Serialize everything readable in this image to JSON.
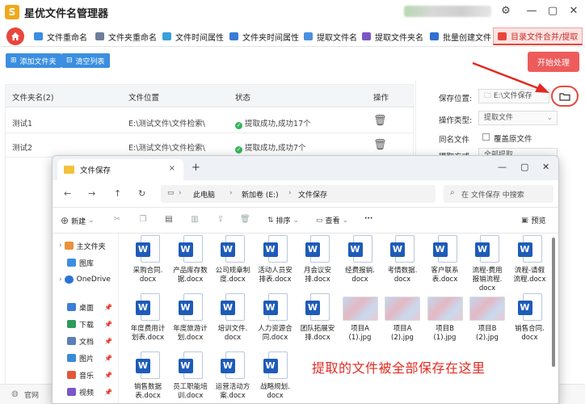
{
  "app": {
    "title": "星优文件名管理器",
    "logo_letter": "S",
    "accent": "#e8463c"
  },
  "tabs": [
    {
      "label": "文件重命名"
    },
    {
      "label": "文件夹重命名"
    },
    {
      "label": "文件时间属性"
    },
    {
      "label": "文件夹时间属性"
    },
    {
      "label": "提取文件名"
    },
    {
      "label": "提取文件夹名"
    },
    {
      "label": "批量创建文件"
    },
    {
      "label": "目录文件合并/提取",
      "active": true
    }
  ],
  "toolbar": {
    "add_folder": "添加文件夹",
    "clear_list": "清空列表",
    "start": "开始处理"
  },
  "table": {
    "headers": [
      "文件夹名(2)",
      "文件位置",
      "状态",
      "操作"
    ],
    "rows": [
      {
        "name": "测试1",
        "path": "E:\\测试文件\\文件检索\\",
        "status": "提取成功,成功17个"
      },
      {
        "name": "测试2",
        "path": "E:\\测试文件\\文件检索\\",
        "status": "提取成功,成功7个"
      }
    ]
  },
  "settings": {
    "save_label": "保存位置:",
    "save_value": "E:\\文件保存",
    "op_label": "操作类型:",
    "op_value": "提取文件",
    "same_label": "同名文件",
    "same_value": "覆盖原文件",
    "extract_label": "提取方式",
    "extract_value": "全部提取"
  },
  "status_bar": {
    "link": "官网"
  },
  "explorer": {
    "tab_title": "文件保存",
    "tab_close": "×",
    "new_tab": "+",
    "breadcrumb": [
      "此电脑",
      "新加卷 (E:)",
      "文件保存"
    ],
    "search_placeholder": "在 文件保存 中搜索",
    "new_label": "新建",
    "sort_label": "排序",
    "view_label": "查看",
    "more_label": "···",
    "preview_label": "预览",
    "sidebar": [
      {
        "label": "主文件夹",
        "color": "#e9913a"
      },
      {
        "label": "图库",
        "color": "#3b8ee0"
      },
      {
        "label": "OneDrive",
        "color": "#2a73d6"
      },
      {
        "label": "桌面",
        "color": "#3d7ed8",
        "pin": true
      },
      {
        "label": "下载",
        "color": "#2e9a5b",
        "pin": true
      },
      {
        "label": "文档",
        "color": "#5b7fb7",
        "pin": true
      },
      {
        "label": "图片",
        "color": "#3a8ad8",
        "pin": true
      },
      {
        "label": "音乐",
        "color": "#e2573a",
        "pin": true
      },
      {
        "label": "视频",
        "color": "#7b56c7",
        "pin": true
      }
    ],
    "files": [
      {
        "name": "采购合同.\ndocx",
        "type": "docx"
      },
      {
        "name": "产品库存数\n据.docx",
        "type": "docx"
      },
      {
        "name": "公司规章制\n度.docx",
        "type": "docx"
      },
      {
        "name": "活动人员安\n排表.docx",
        "type": "docx"
      },
      {
        "name": "月会议安\n排.docx",
        "type": "docx"
      },
      {
        "name": "经费报销.\ndocx",
        "type": "docx"
      },
      {
        "name": "考情数据.\ndocx",
        "type": "docx"
      },
      {
        "name": "客户联系\n表.docx",
        "type": "docx"
      },
      {
        "name": "流程-费用\n报销流程.\ndocx",
        "type": "docx"
      },
      {
        "name": "流程-请假\n流程.docx",
        "type": "docx"
      },
      {
        "name": "年度费用计\n划表.docx",
        "type": "docx"
      },
      {
        "name": "年度旅游计\n划.docx",
        "type": "docx"
      },
      {
        "name": "培训文件.\ndocx",
        "type": "docx"
      },
      {
        "name": "人力资源合\n同.docx",
        "type": "docx"
      },
      {
        "name": "团队拓展安\n排.docx",
        "type": "docx"
      },
      {
        "name": "项目A\n(1).jpg",
        "type": "jpg"
      },
      {
        "name": "项目A\n(2).jpg",
        "type": "jpg"
      },
      {
        "name": "项目B\n(1).jpg",
        "type": "jpg"
      },
      {
        "name": "项目B\n(2).jpg",
        "type": "jpg"
      },
      {
        "name": "销售合同.\ndocx",
        "type": "docx"
      },
      {
        "name": "销售数据\n表.docx",
        "type": "docx"
      },
      {
        "name": "员工职能培\n训.docx",
        "type": "docx"
      },
      {
        "name": "运营活动方\n案.docx",
        "type": "docx"
      },
      {
        "name": "战略规划.\ndocx",
        "type": "docx"
      }
    ]
  },
  "annotation": {
    "banner": "提取的文件被全部保存在这里"
  }
}
